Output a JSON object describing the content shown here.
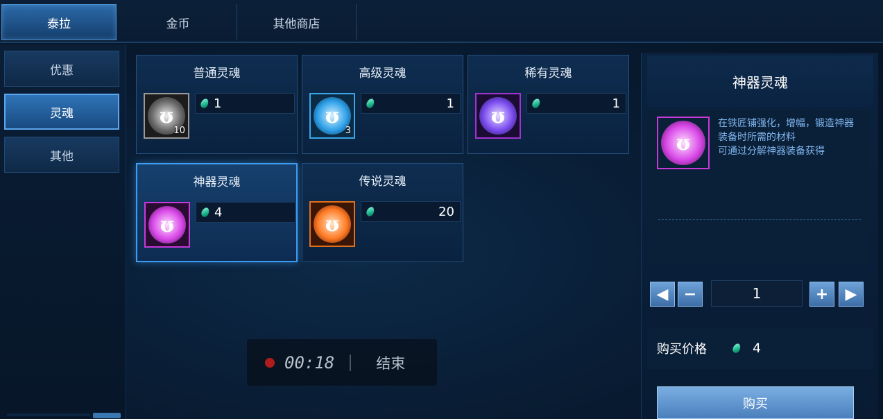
{
  "top_tabs": [
    {
      "label": "泰拉",
      "active": true
    },
    {
      "label": "金币",
      "active": false
    },
    {
      "label": "其他商店",
      "active": false
    }
  ],
  "sidebar": {
    "items": [
      {
        "label": "优惠",
        "active": false
      },
      {
        "label": "灵魂",
        "active": true
      },
      {
        "label": "其他",
        "active": false
      }
    ]
  },
  "items": [
    {
      "name": "普通灵魂",
      "quantity": "10",
      "price": "1",
      "color": "#d8d8d8",
      "border": "#9a9a9a"
    },
    {
      "name": "高级灵魂",
      "quantity": "3",
      "price": "1",
      "color": "#39b4ff",
      "border": "#3aa6e8"
    },
    {
      "name": "稀有灵魂",
      "quantity": "",
      "price": "1",
      "color": "#8a5cff",
      "border": "#a034d0"
    },
    {
      "name": "神器灵魂",
      "quantity": "",
      "price": "4",
      "color": "#e04cf0",
      "border": "#c63ad8"
    },
    {
      "name": "传说灵魂",
      "quantity": "",
      "price": "20",
      "color": "#ff7a2a",
      "border": "#e0701e"
    }
  ],
  "recording": {
    "time": "00:18",
    "end_label": "结束"
  },
  "detail": {
    "title": "神器灵魂",
    "description_lines": [
      "在铁匠铺强化，增幅，锻造神器",
      "装备时所需的材料",
      "可通过分解神器装备获得"
    ],
    "quantity": "1",
    "buy_price_label": "购买价格",
    "buy_price": "4",
    "buy_button": "购买"
  },
  "icons": {
    "currency": "terra-gem-icon",
    "soul": "soul-orb-icon"
  }
}
